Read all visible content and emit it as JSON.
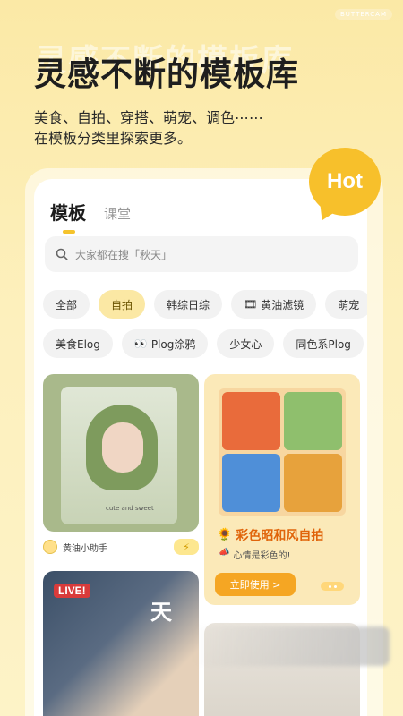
{
  "brand": "BUTTERCAM",
  "ghost_title": "灵感不断的模板库",
  "headline": "灵感不断的模板库",
  "subline_1": "美食、自拍、穿搭、萌宠、调色⋯⋯",
  "subline_2": "在模板分类里探索更多。",
  "hot_badge": "Hot",
  "tabs": {
    "active": "模板",
    "inactive": "课堂"
  },
  "search": {
    "placeholder": "大家都在搜「秋天」"
  },
  "chips_row1": [
    {
      "label": "全部",
      "emoji": ""
    },
    {
      "label": "自拍",
      "emoji": ""
    },
    {
      "label": "韩综日综",
      "emoji": ""
    },
    {
      "label": "黄油滤镜",
      "emoji": "🎞"
    },
    {
      "label": "萌宠",
      "emoji": ""
    }
  ],
  "chips_row2": [
    {
      "label": "美食Elog",
      "emoji": ""
    },
    {
      "label": "Plog涂鸦",
      "emoji": "👀"
    },
    {
      "label": "少女心",
      "emoji": ""
    },
    {
      "label": "同色系Plog",
      "emoji": ""
    }
  ],
  "tile_a": {
    "caption_art": "cute and sweet",
    "author": "黄油小助手",
    "action_icon": "⚡"
  },
  "tile_b": {
    "icon": "🌻",
    "title": "彩色昭和风自拍",
    "sub_icon": "📣",
    "subtitle": "心情是彩色的!",
    "button": "立即使用 >"
  },
  "tile_c": {
    "badge": "LIVE!",
    "char": "天"
  }
}
